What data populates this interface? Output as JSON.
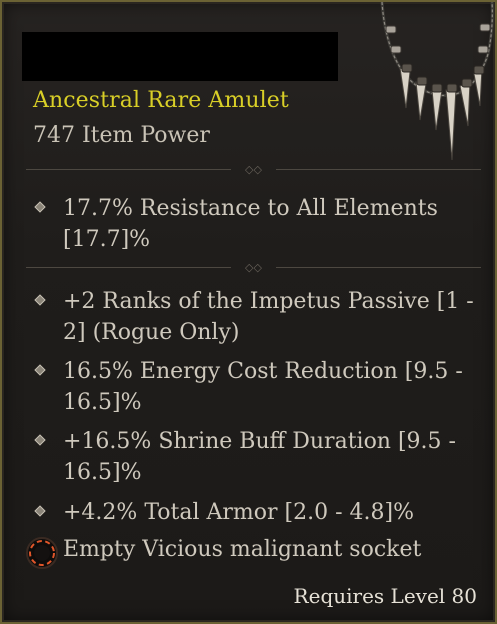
{
  "item": {
    "type_line": "Ancestral Rare Amulet",
    "item_power": "747 Item Power",
    "rarity_color": "#d9cf27",
    "icon": "fang-necklace-icon"
  },
  "implicit": [
    {
      "line1": "17.7% Resistance to All Elements",
      "line2": "[17.7]%"
    }
  ],
  "affixes": [
    {
      "line1": "+2 Ranks of the Impetus Passive [1 -",
      "line2": "2] (Rogue Only)"
    },
    {
      "line1": "16.5% Energy Cost Reduction [9.5 -",
      "line2": "16.5]%"
    },
    {
      "line1": "+16.5% Shrine Buff Duration [9.5 -",
      "line2": "16.5]%"
    },
    {
      "line1": "+4.2% Total Armor [2.0 - 4.8]%",
      "line2": ""
    }
  ],
  "socket": {
    "label": "Empty Vicious malignant socket",
    "icon": "malignant-socket-icon",
    "color": "#e0562a"
  },
  "requirement": "Requires Level 80"
}
